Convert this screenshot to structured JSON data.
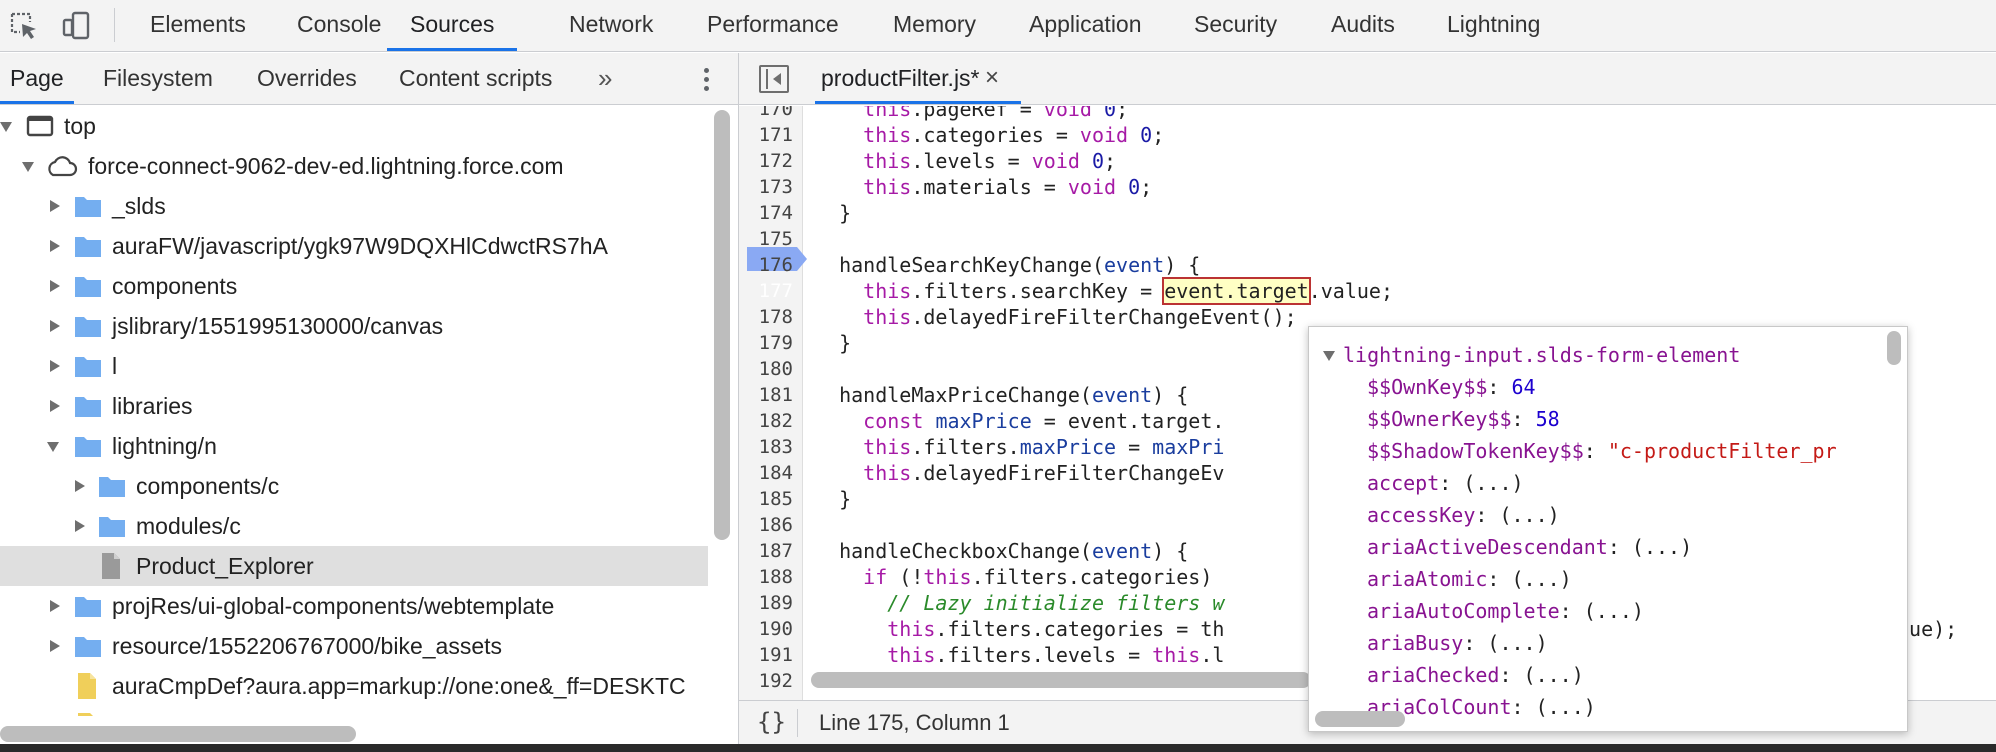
{
  "main_tabs": [
    "Elements",
    "Console",
    "Sources",
    "Network",
    "Performance",
    "Memory",
    "Application",
    "Security",
    "Audits",
    "Lightning"
  ],
  "active_main_tab": "Sources",
  "navigator": {
    "tabs": [
      "Page",
      "Filesystem",
      "Overrides",
      "Content scripts"
    ],
    "more": "»",
    "tree": [
      {
        "label": "top",
        "icon": "frame-icon"
      },
      {
        "label": "force-connect-9062-dev-ed.lightning.force.com",
        "icon": "cloud-icon"
      },
      {
        "label": "_slds",
        "icon": "folder-icon"
      },
      {
        "label": "auraFW/javascript/ygk97W9DQXHlCdwctRS7hA",
        "icon": "folder-icon"
      },
      {
        "label": "components",
        "icon": "folder-icon"
      },
      {
        "label": "jslibrary/1551995130000/canvas",
        "icon": "folder-icon"
      },
      {
        "label": "l",
        "icon": "folder-icon"
      },
      {
        "label": "libraries",
        "icon": "folder-icon"
      },
      {
        "label": "lightning/n",
        "icon": "folder-icon"
      },
      {
        "label": "components/c",
        "icon": "folder-icon"
      },
      {
        "label": "modules/c",
        "icon": "folder-icon"
      },
      {
        "label": "Product_Explorer",
        "icon": "file-icon"
      },
      {
        "label": "projRes/ui-global-components/webtemplate",
        "icon": "folder-icon"
      },
      {
        "label": "resource/1552206767000/bike_assets",
        "icon": "folder-icon"
      },
      {
        "label": "auraCmpDef?aura.app=markup://one:one&_ff=DESKTC",
        "icon": "script-file-icon"
      }
    ]
  },
  "editor": {
    "file_tab": "productFilter.js*",
    "close": "×",
    "breakpoint_line": 177,
    "lines": [
      {
        "n": "170",
        "t": "    this.pageRef = void 0;"
      },
      {
        "n": "171",
        "t": "    this.categories = void 0;"
      },
      {
        "n": "172",
        "t": "    this.levels = void 0;"
      },
      {
        "n": "173",
        "t": "    this.materials = void 0;"
      },
      {
        "n": "174",
        "t": "  }"
      },
      {
        "n": "175",
        "t": ""
      },
      {
        "n": "176",
        "t": "  handleSearchKeyChange(event) {"
      },
      {
        "n": "177",
        "t": "    this.filters.searchKey = event.target.value;"
      },
      {
        "n": "178",
        "t": "    this.delayedFireFilterChangeEvent();"
      },
      {
        "n": "179",
        "t": "  }"
      },
      {
        "n": "180",
        "t": ""
      },
      {
        "n": "181",
        "t": "  handleMaxPriceChange(event) {"
      },
      {
        "n": "182",
        "t": "    const maxPrice = event.target."
      },
      {
        "n": "183",
        "t": "    this.filters.maxPrice = maxPri"
      },
      {
        "n": "184",
        "t": "    this.delayedFireFilterChangeEv"
      },
      {
        "n": "185",
        "t": "  }"
      },
      {
        "n": "186",
        "t": ""
      },
      {
        "n": "187",
        "t": "  handleCheckboxChange(event) {"
      },
      {
        "n": "188",
        "t": "    if (!this.filters.categories)"
      },
      {
        "n": "189",
        "t": "      // Lazy initialize filters w"
      },
      {
        "n": "190",
        "t": "      this.filters.categories = th"
      },
      {
        "n": "191",
        "t": "      this.filters.levels = this.l"
      },
      {
        "n": "192",
        "t": ""
      }
    ],
    "line190_tail": "lue);"
  },
  "status": {
    "format_icon": "{}",
    "cursor": "Line 175, Column 1"
  },
  "popover": {
    "title": "lightning-input.slds-form-element",
    "props": [
      {
        "key": "$$OwnKey$$",
        "val": "64",
        "kind": "num"
      },
      {
        "key": "$$OwnerKey$$",
        "val": "58",
        "kind": "num"
      },
      {
        "key": "$$ShadowTokenKey$$",
        "val": "\"c-productFilter_pr",
        "kind": "str"
      },
      {
        "key": "accept",
        "val": "(...)",
        "kind": "getter"
      },
      {
        "key": "accessKey",
        "val": "(...)",
        "kind": "getter"
      },
      {
        "key": "ariaActiveDescendant",
        "val": "(...)",
        "kind": "getter"
      },
      {
        "key": "ariaAtomic",
        "val": "(...)",
        "kind": "getter"
      },
      {
        "key": "ariaAutoComplete",
        "val": "(...)",
        "kind": "getter"
      },
      {
        "key": "ariaBusy",
        "val": "(...)",
        "kind": "getter"
      },
      {
        "key": "ariaChecked",
        "val": "(...)",
        "kind": "getter"
      },
      {
        "key": "ariaColCount",
        "val": "(...)",
        "kind": "getter"
      }
    ]
  },
  "colors": {
    "accent": "#1a73e8",
    "breakpoint": "#8aa9f3",
    "keyword": "#a61aa6",
    "comment": "#2a8a2a"
  }
}
